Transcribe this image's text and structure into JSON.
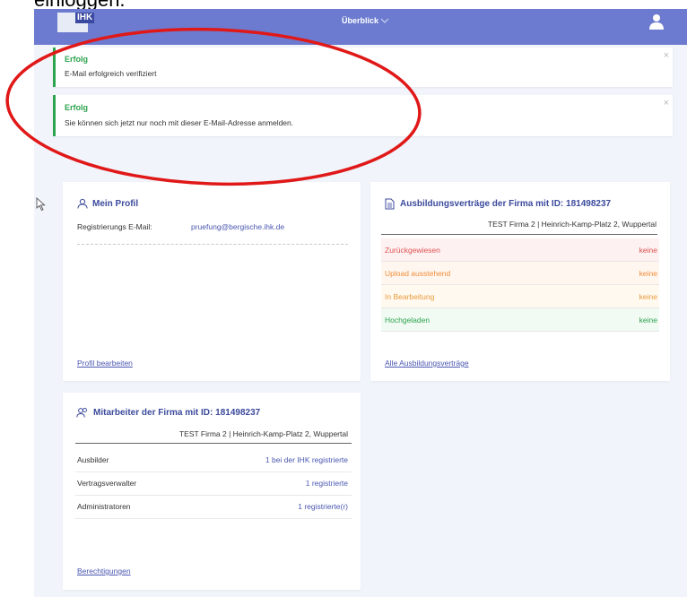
{
  "caption": "einloggen.",
  "header": {
    "logo_text": "IHK",
    "nav_title": "Überblick",
    "nav_chevron_icon": "chevron-down-icon",
    "user_icon": "user-icon",
    "bar_color": "#6c7bcf"
  },
  "alerts": [
    {
      "title": "Erfolg",
      "message": "E-Mail erfolgreich verifiziert"
    },
    {
      "title": "Erfolg",
      "message": "Sie können sich jetzt nur noch mit dieser E-Mail-Adresse anmelden."
    }
  ],
  "profile": {
    "title": "Mein Profil",
    "email_label": "Registrierungs E-Mail:",
    "email_value": "pruefung@bergische.ihk.de",
    "edit_link": "Profil bearbeiten"
  },
  "contracts": {
    "title": "Ausbildungsverträge der Firma mit ID: 181498237",
    "company": "TEST Firma 2 | Heinrich-Kamp-Platz 2, Wuppertal",
    "rows": [
      {
        "label": "Zurückgewiesen",
        "value": "keine",
        "color": "#e05252",
        "bg": "#fdf1f1"
      },
      {
        "label": "Upload ausstehend",
        "value": "keine",
        "color": "#f08c3a",
        "bg": "#fff7ef"
      },
      {
        "label": "In Bearbeitung",
        "value": "keine",
        "color": "#e89a3a",
        "bg": "#fff9f0"
      },
      {
        "label": "Hochgeladen",
        "value": "keine",
        "color": "#2ea44f",
        "bg": "#f1faf3"
      }
    ],
    "all_link": "Alle Ausbildungsverträge"
  },
  "staff": {
    "title": "Mitarbeiter der Firma mit ID: 181498237",
    "company": "TEST Firma 2 | Heinrich-Kamp-Platz 2, Wuppertal",
    "rows": [
      {
        "label": "Ausbilder",
        "count": "1",
        "suffix": "bei der IHK registrierte"
      },
      {
        "label": "Vertragsverwalter",
        "count": "1",
        "suffix": "registrierte"
      },
      {
        "label": "Administratoren",
        "count": "1",
        "suffix": "registrierte(r)"
      }
    ],
    "permissions_link": "Berechtigungen"
  }
}
